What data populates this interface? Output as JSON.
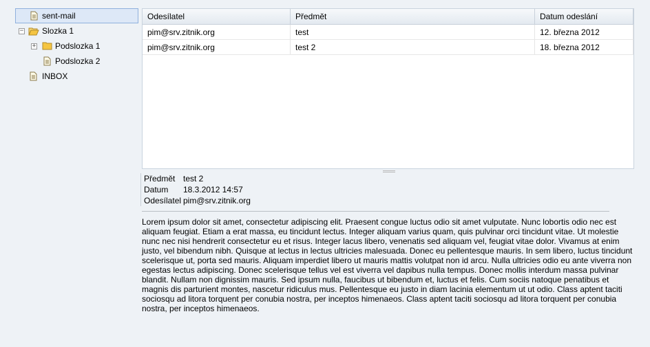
{
  "folders": [
    {
      "label": "sent-mail",
      "icon": "document-icon",
      "selected": true
    },
    {
      "label": "Slozka 1",
      "icon": "folder-open-icon",
      "expander": "−"
    },
    {
      "label": "Podslozka 1",
      "icon": "folder-icon",
      "expander": "+"
    },
    {
      "label": "Podslozka 2",
      "icon": "document-icon"
    },
    {
      "label": "INBOX",
      "icon": "document-icon"
    }
  ],
  "list": {
    "headers": [
      "Odesílatel",
      "Předmět",
      "Datum odeslání"
    ],
    "rows": [
      {
        "sender": "pim@srv.zitnik.org",
        "subject": "test",
        "date": "12. března 2012"
      },
      {
        "sender": "pim@srv.zitnik.org",
        "subject": "test 2",
        "date": "18. března 2012"
      }
    ]
  },
  "preview": {
    "subject_label": "Předmět",
    "subject": "test 2",
    "date_label": "Datum",
    "date": "18.3.2012 14:57",
    "sender_label": "Odesílatel",
    "sender": "pim@srv.zitnik.org",
    "body": "Lorem ipsum dolor sit amet, consectetur adipiscing elit. Praesent congue luctus odio sit amet vulputate. Nunc lobortis odio nec est aliquam feugiat. Etiam a erat massa, eu tincidunt lectus. Integer aliquam varius quam, quis pulvinar orci tincidunt vitae. Ut molestie nunc nec nisi hendrerit consectetur eu et risus. Integer lacus libero, venenatis sed aliquam vel, feugiat vitae dolor. Vivamus at enim justo, vel bibendum nibh. Quisque at lectus in lectus ultricies malesuada. Donec eu pellentesque mauris. In sem libero, luctus tincidunt scelerisque ut, porta sed mauris. Aliquam imperdiet libero ut mauris mattis volutpat non id arcu. Nulla ultricies odio eu ante viverra non egestas lectus adipiscing. Donec scelerisque tellus vel est viverra vel dapibus nulla tempus. Donec mollis interdum massa pulvinar blandit. Nullam non dignissim mauris. Sed ipsum nulla, faucibus ut bibendum et, luctus et felis. Cum sociis natoque penatibus et magnis dis parturient montes, nascetur ridiculus mus. Pellentesque eu justo in diam lacinia elementum ut ut odio. Class aptent taciti sociosqu ad litora torquent per conubia nostra, per inceptos himenaeos. Class aptent taciti sociosqu ad litora torquent per conubia nostra, per inceptos himenaeos."
  },
  "colors": {
    "background": "#eef2f6",
    "selection": "#dde8f7",
    "selection_border": "#8fb0dd",
    "folder": "#f5c542"
  }
}
